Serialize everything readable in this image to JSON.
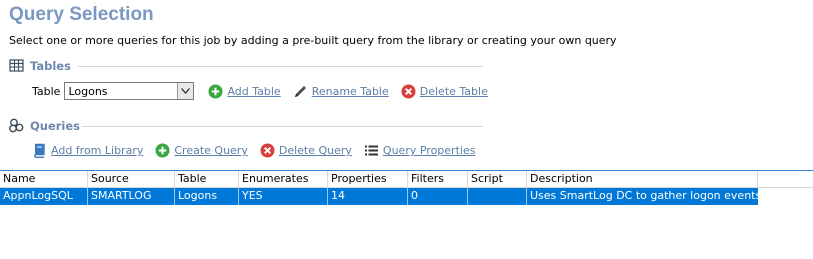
{
  "page": {
    "title": "Query Selection",
    "subtitle": "Select one or more queries for this job by adding a pre-built query from the library or creating your own query"
  },
  "tables_section": {
    "label": "Tables",
    "table_label": "Table",
    "selected_table": "Logons",
    "add_label": "Add Table",
    "rename_label": "Rename Table",
    "delete_label": "Delete Table"
  },
  "queries_section": {
    "label": "Queries",
    "add_from_library_label": "Add from Library",
    "create_label": "Create Query",
    "delete_label": "Delete Query",
    "properties_label": "Query Properties"
  },
  "grid": {
    "columns": [
      "Name",
      "Source",
      "Table",
      "Enumerates",
      "Properties",
      "Filters",
      "Script",
      "Description"
    ],
    "rows": [
      [
        "AppnLogSQL",
        "SMARTLOG",
        "Logons",
        "YES",
        "14",
        "0",
        "",
        "Uses SmartLog DC to gather logon events"
      ]
    ]
  },
  "colors": {
    "title": "#7a97c2",
    "section_label": "#6e87ad",
    "link": "#5b7fa8",
    "selection": "#0078d7",
    "add_green": "#3aa842",
    "delete_red": "#d9403b"
  }
}
